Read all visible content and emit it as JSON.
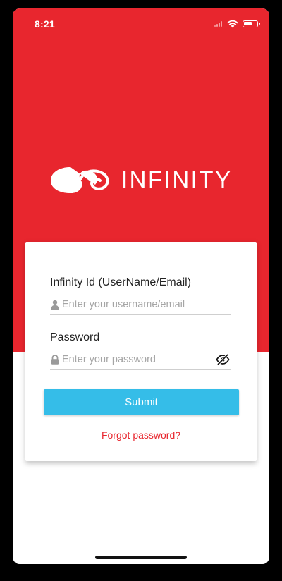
{
  "status_bar": {
    "time": "8:21"
  },
  "brand": {
    "name": "INFINITY",
    "primary_color": "#e8262e",
    "accent_color": "#35bde8"
  },
  "login": {
    "username_label": "Infinity Id (UserName/Email)",
    "username_placeholder": "Enter your username/email",
    "password_label": "Password",
    "password_placeholder": "Enter your password",
    "submit_label": "Submit",
    "forgot_label": "Forgot password?"
  },
  "icons": {
    "username": "user-icon",
    "password": "lock-icon",
    "visibility": "eye-slash-icon"
  }
}
